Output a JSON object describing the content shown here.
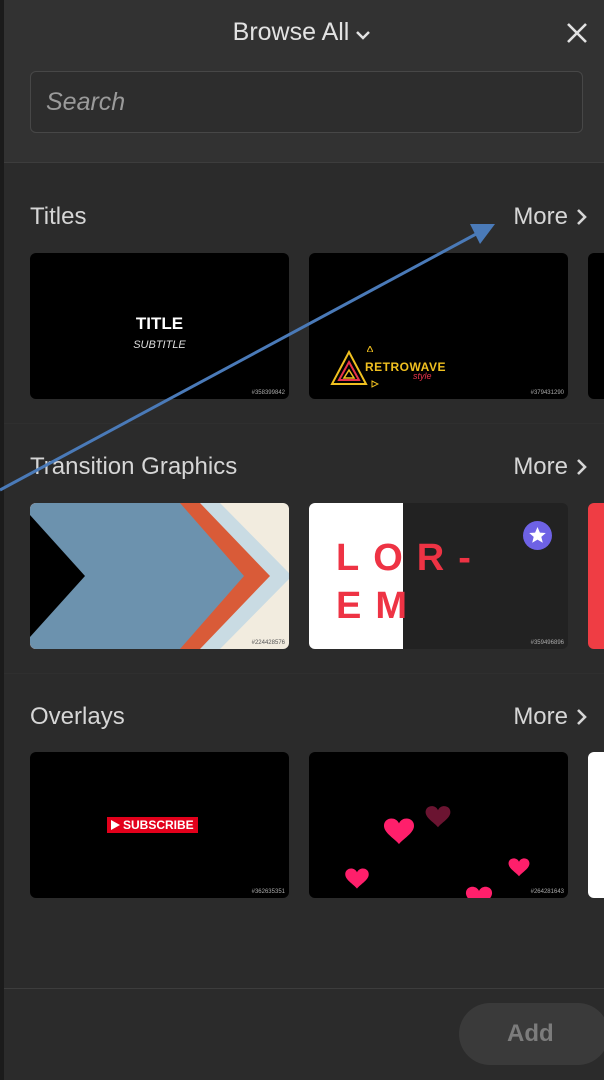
{
  "header": {
    "title": "Browse All",
    "title_icon": "chevron-down-icon",
    "close_icon": "close-icon"
  },
  "search": {
    "placeholder": "Search",
    "value": ""
  },
  "sections": [
    {
      "title": "Titles",
      "more_label": "More",
      "items": [
        {
          "title_text": "TITLE",
          "subtitle_text": "SUBTITLE",
          "id": "#358399842"
        },
        {
          "title_text": "RETROWAVE",
          "script_text": "style",
          "id": "#379431290"
        }
      ]
    },
    {
      "title": "Transition Graphics",
      "more_label": "More",
      "items": [
        {
          "id": "#224428576"
        },
        {
          "line1": "LOR-",
          "line2": "EM",
          "badge_icon": "star-icon",
          "id": "#359496896"
        }
      ]
    },
    {
      "title": "Overlays",
      "more_label": "More",
      "items": [
        {
          "button_text": "SUBSCRIBE",
          "id": "#362635351"
        },
        {
          "id": "#264281643"
        }
      ]
    }
  ],
  "footer": {
    "add_label": "Add"
  },
  "colors": {
    "background": "#2b2b2b",
    "annotation_arrow": "#4a7ab8",
    "retrowave": "#f0c020",
    "lorem_red": "#ee3344",
    "heart_pink": "#ff1f6b",
    "subscribe_red": "#e3001b"
  }
}
